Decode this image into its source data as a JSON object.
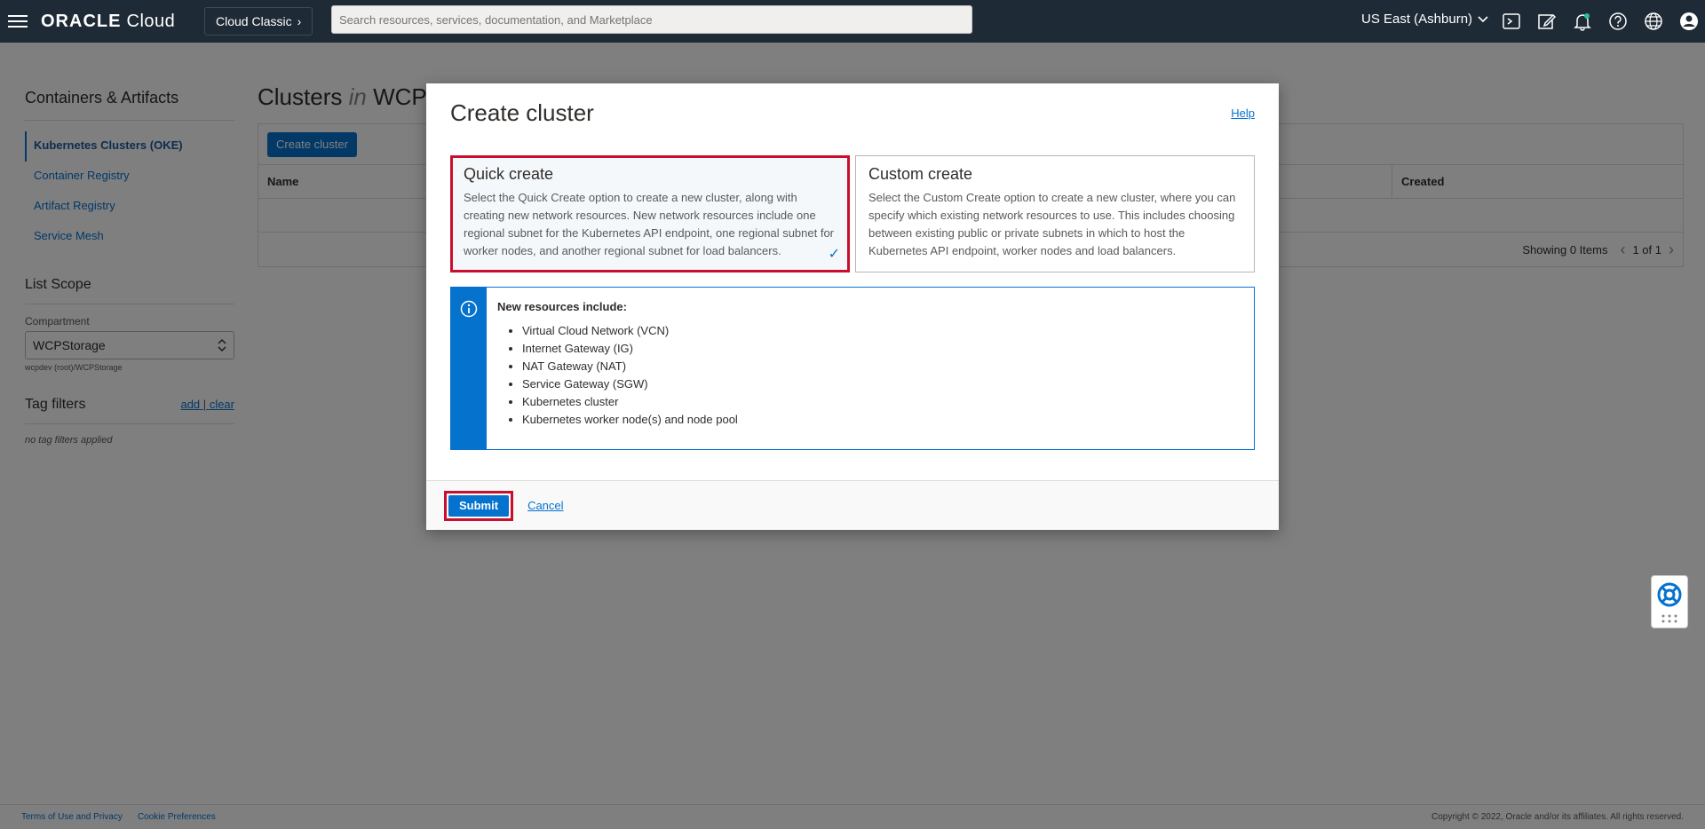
{
  "topbar": {
    "logo_brand": "ORACLE",
    "logo_product": "Cloud",
    "classic_label": "Cloud Classic",
    "search_placeholder": "Search resources, services, documentation, and Marketplace",
    "region": "US East (Ashburn)",
    "icons": [
      "cloud-shell-icon",
      "edit-icon",
      "notifications-icon",
      "help-icon",
      "globe-icon",
      "profile-icon"
    ]
  },
  "sidebar": {
    "title": "Containers & Artifacts",
    "items": [
      {
        "label": "Kubernetes Clusters (OKE)",
        "active": true
      },
      {
        "label": "Container Registry"
      },
      {
        "label": "Artifact Registry"
      },
      {
        "label": "Service Mesh"
      }
    ],
    "scope_title": "List Scope",
    "compartment_label": "Compartment",
    "compartment_value": "WCPStorage",
    "compartment_path": "wcpdev (root)/WCPStorage",
    "tag_title": "Tag filters",
    "tag_add": "add",
    "tag_sep": "|",
    "tag_clear": "clear",
    "tag_empty": "no tag filters applied"
  },
  "main": {
    "title_prefix": "Clusters",
    "title_in": "in",
    "title_suffix": "WCP",
    "create_button": "Create cluster",
    "columns": {
      "name": "Name",
      "created": "Created"
    },
    "showing": "Showing 0 Items",
    "pager": "1 of 1"
  },
  "modal": {
    "title": "Create cluster",
    "help": "Help",
    "options": [
      {
        "title": "Quick create",
        "desc": "Select the Quick Create option to create a new cluster, along with creating new network resources. New network resources include one regional subnet for the Kubernetes API endpoint, one regional subnet for worker nodes, and another regional subnet for load balancers.",
        "selected": true
      },
      {
        "title": "Custom create",
        "desc": "Select the Custom Create option to create a new cluster, where you can specify which existing network resources to use. This includes choosing between existing public or private subnets in which to host the Kubernetes API endpoint, worker nodes and load balancers.",
        "selected": false
      }
    ],
    "info_heading": "New resources include:",
    "info_items": [
      "Virtual Cloud Network (VCN)",
      "Internet Gateway (IG)",
      "NAT Gateway (NAT)",
      "Service Gateway (SGW)",
      "Kubernetes cluster",
      "Kubernetes worker node(s) and node pool"
    ],
    "submit": "Submit",
    "cancel": "Cancel"
  },
  "footer": {
    "terms": "Terms of Use and Privacy",
    "cookies": "Cookie Preferences",
    "copyright": "Copyright © 2022, Oracle and/or its affiliates. All rights reserved."
  },
  "colors": {
    "topbar": "#1e2a35",
    "accent": "#0572ce",
    "highlight": "#c8102e"
  }
}
